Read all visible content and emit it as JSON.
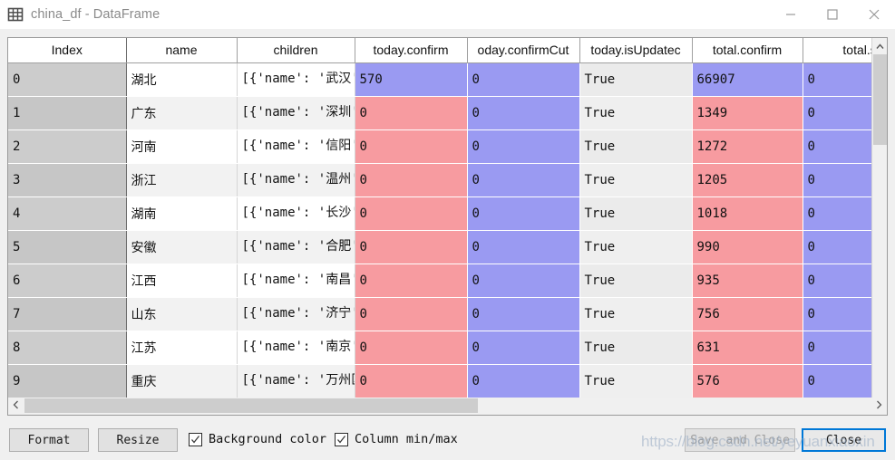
{
  "window": {
    "title": "china_df - DataFrame",
    "icon": "table-grid-icon",
    "controls": [
      {
        "name": "minimize",
        "glyph": "minimize-icon"
      },
      {
        "name": "maximize",
        "glyph": "maximize-icon"
      },
      {
        "name": "close",
        "glyph": "close-icon"
      }
    ]
  },
  "colors": {
    "cell_high": "#9a9af2",
    "cell_low": "#f79ba0",
    "index_bg": "#cccccc",
    "focus_border": "#0078d7",
    "toolbar_bg": "#f0f0f0"
  },
  "table": {
    "columns": [
      {
        "key": "index",
        "label": "Index"
      },
      {
        "key": "name",
        "label": "name"
      },
      {
        "key": "children",
        "label": "children"
      },
      {
        "key": "today_confirm",
        "label": "today.confirm"
      },
      {
        "key": "today_confirmcut",
        "label": "oday.confirmCut"
      },
      {
        "key": "today_isupdated",
        "label": "today.isUpdatec"
      },
      {
        "key": "total_confirm",
        "label": "total.confirm"
      },
      {
        "key": "total_suspect",
        "label": "total.su"
      }
    ],
    "rows": [
      {
        "index": "0",
        "name": "湖北",
        "children": "[{'name': '武汉', 'today'…",
        "today_confirm": "570",
        "today_confirm_color": "high",
        "today_confirmcut": "0",
        "today_confirmcut_color": "high",
        "today_isupdated": "True",
        "total_confirm": "66907",
        "total_confirm_color": "high",
        "total_suspect": "0",
        "total_suspect_color": "high"
      },
      {
        "index": "1",
        "name": "广东",
        "children": "[{'name': '深圳', 'today'…",
        "today_confirm": "0",
        "today_confirm_color": "low",
        "today_confirmcut": "0",
        "today_confirmcut_color": "high",
        "today_isupdated": "True",
        "total_confirm": "1349",
        "total_confirm_color": "low",
        "total_suspect": "0",
        "total_suspect_color": "high"
      },
      {
        "index": "2",
        "name": "河南",
        "children": "[{'name': '信阳', 'today'…",
        "today_confirm": "0",
        "today_confirm_color": "low",
        "today_confirmcut": "0",
        "today_confirmcut_color": "high",
        "today_isupdated": "True",
        "total_confirm": "1272",
        "total_confirm_color": "low",
        "total_suspect": "0",
        "total_suspect_color": "high"
      },
      {
        "index": "3",
        "name": "浙江",
        "children": "[{'name': '温州', 'today'…",
        "today_confirm": "0",
        "today_confirm_color": "low",
        "today_confirmcut": "0",
        "today_confirmcut_color": "high",
        "today_isupdated": "True",
        "total_confirm": "1205",
        "total_confirm_color": "low",
        "total_suspect": "0",
        "total_suspect_color": "high"
      },
      {
        "index": "4",
        "name": "湖南",
        "children": "[{'name': '长沙', 'today'…",
        "today_confirm": "0",
        "today_confirm_color": "low",
        "today_confirmcut": "0",
        "today_confirmcut_color": "high",
        "today_isupdated": "True",
        "total_confirm": "1018",
        "total_confirm_color": "low",
        "total_suspect": "0",
        "total_suspect_color": "high"
      },
      {
        "index": "5",
        "name": "安徽",
        "children": "[{'name': '合肥', 'today'…",
        "today_confirm": "0",
        "today_confirm_color": "low",
        "today_confirmcut": "0",
        "today_confirmcut_color": "high",
        "today_isupdated": "True",
        "total_confirm": "990",
        "total_confirm_color": "low",
        "total_suspect": "0",
        "total_suspect_color": "high"
      },
      {
        "index": "6",
        "name": "江西",
        "children": "[{'name': '南昌', 'today'…",
        "today_confirm": "0",
        "today_confirm_color": "low",
        "today_confirmcut": "0",
        "today_confirmcut_color": "high",
        "today_isupdated": "True",
        "total_confirm": "935",
        "total_confirm_color": "low",
        "total_suspect": "0",
        "total_suspect_color": "high"
      },
      {
        "index": "7",
        "name": "山东",
        "children": "[{'name': '济宁', 'today'…",
        "today_confirm": "0",
        "today_confirm_color": "low",
        "today_confirmcut": "0",
        "today_confirmcut_color": "high",
        "today_isupdated": "True",
        "total_confirm": "756",
        "total_confirm_color": "low",
        "total_suspect": "0",
        "total_suspect_color": "high"
      },
      {
        "index": "8",
        "name": "江苏",
        "children": "[{'name': '南京', 'today'…",
        "today_confirm": "0",
        "today_confirm_color": "low",
        "today_confirmcut": "0",
        "today_confirmcut_color": "high",
        "today_isupdated": "True",
        "total_confirm": "631",
        "total_confirm_color": "low",
        "total_suspect": "0",
        "total_suspect_color": "high"
      },
      {
        "index": "9",
        "name": "重庆",
        "children": "[{'name': '万州区', 'toda…",
        "today_confirm": "0",
        "today_confirm_color": "low",
        "today_confirmcut": "0",
        "today_confirmcut_color": "high",
        "today_isupdated": "True",
        "total_confirm": "576",
        "total_confirm_color": "low",
        "total_suspect": "0",
        "total_suspect_color": "high"
      }
    ]
  },
  "toolbar": {
    "format_label": "Format",
    "resize_label": "Resize",
    "background_color_label": "Background color",
    "background_color_checked": true,
    "column_minmax_label": "Column min/max",
    "column_minmax_checked": true,
    "save_and_close_label": "Save and Close",
    "close_label": "Close"
  },
  "watermark": "https://blog.csdn.net/yeyuanxiaoxin"
}
